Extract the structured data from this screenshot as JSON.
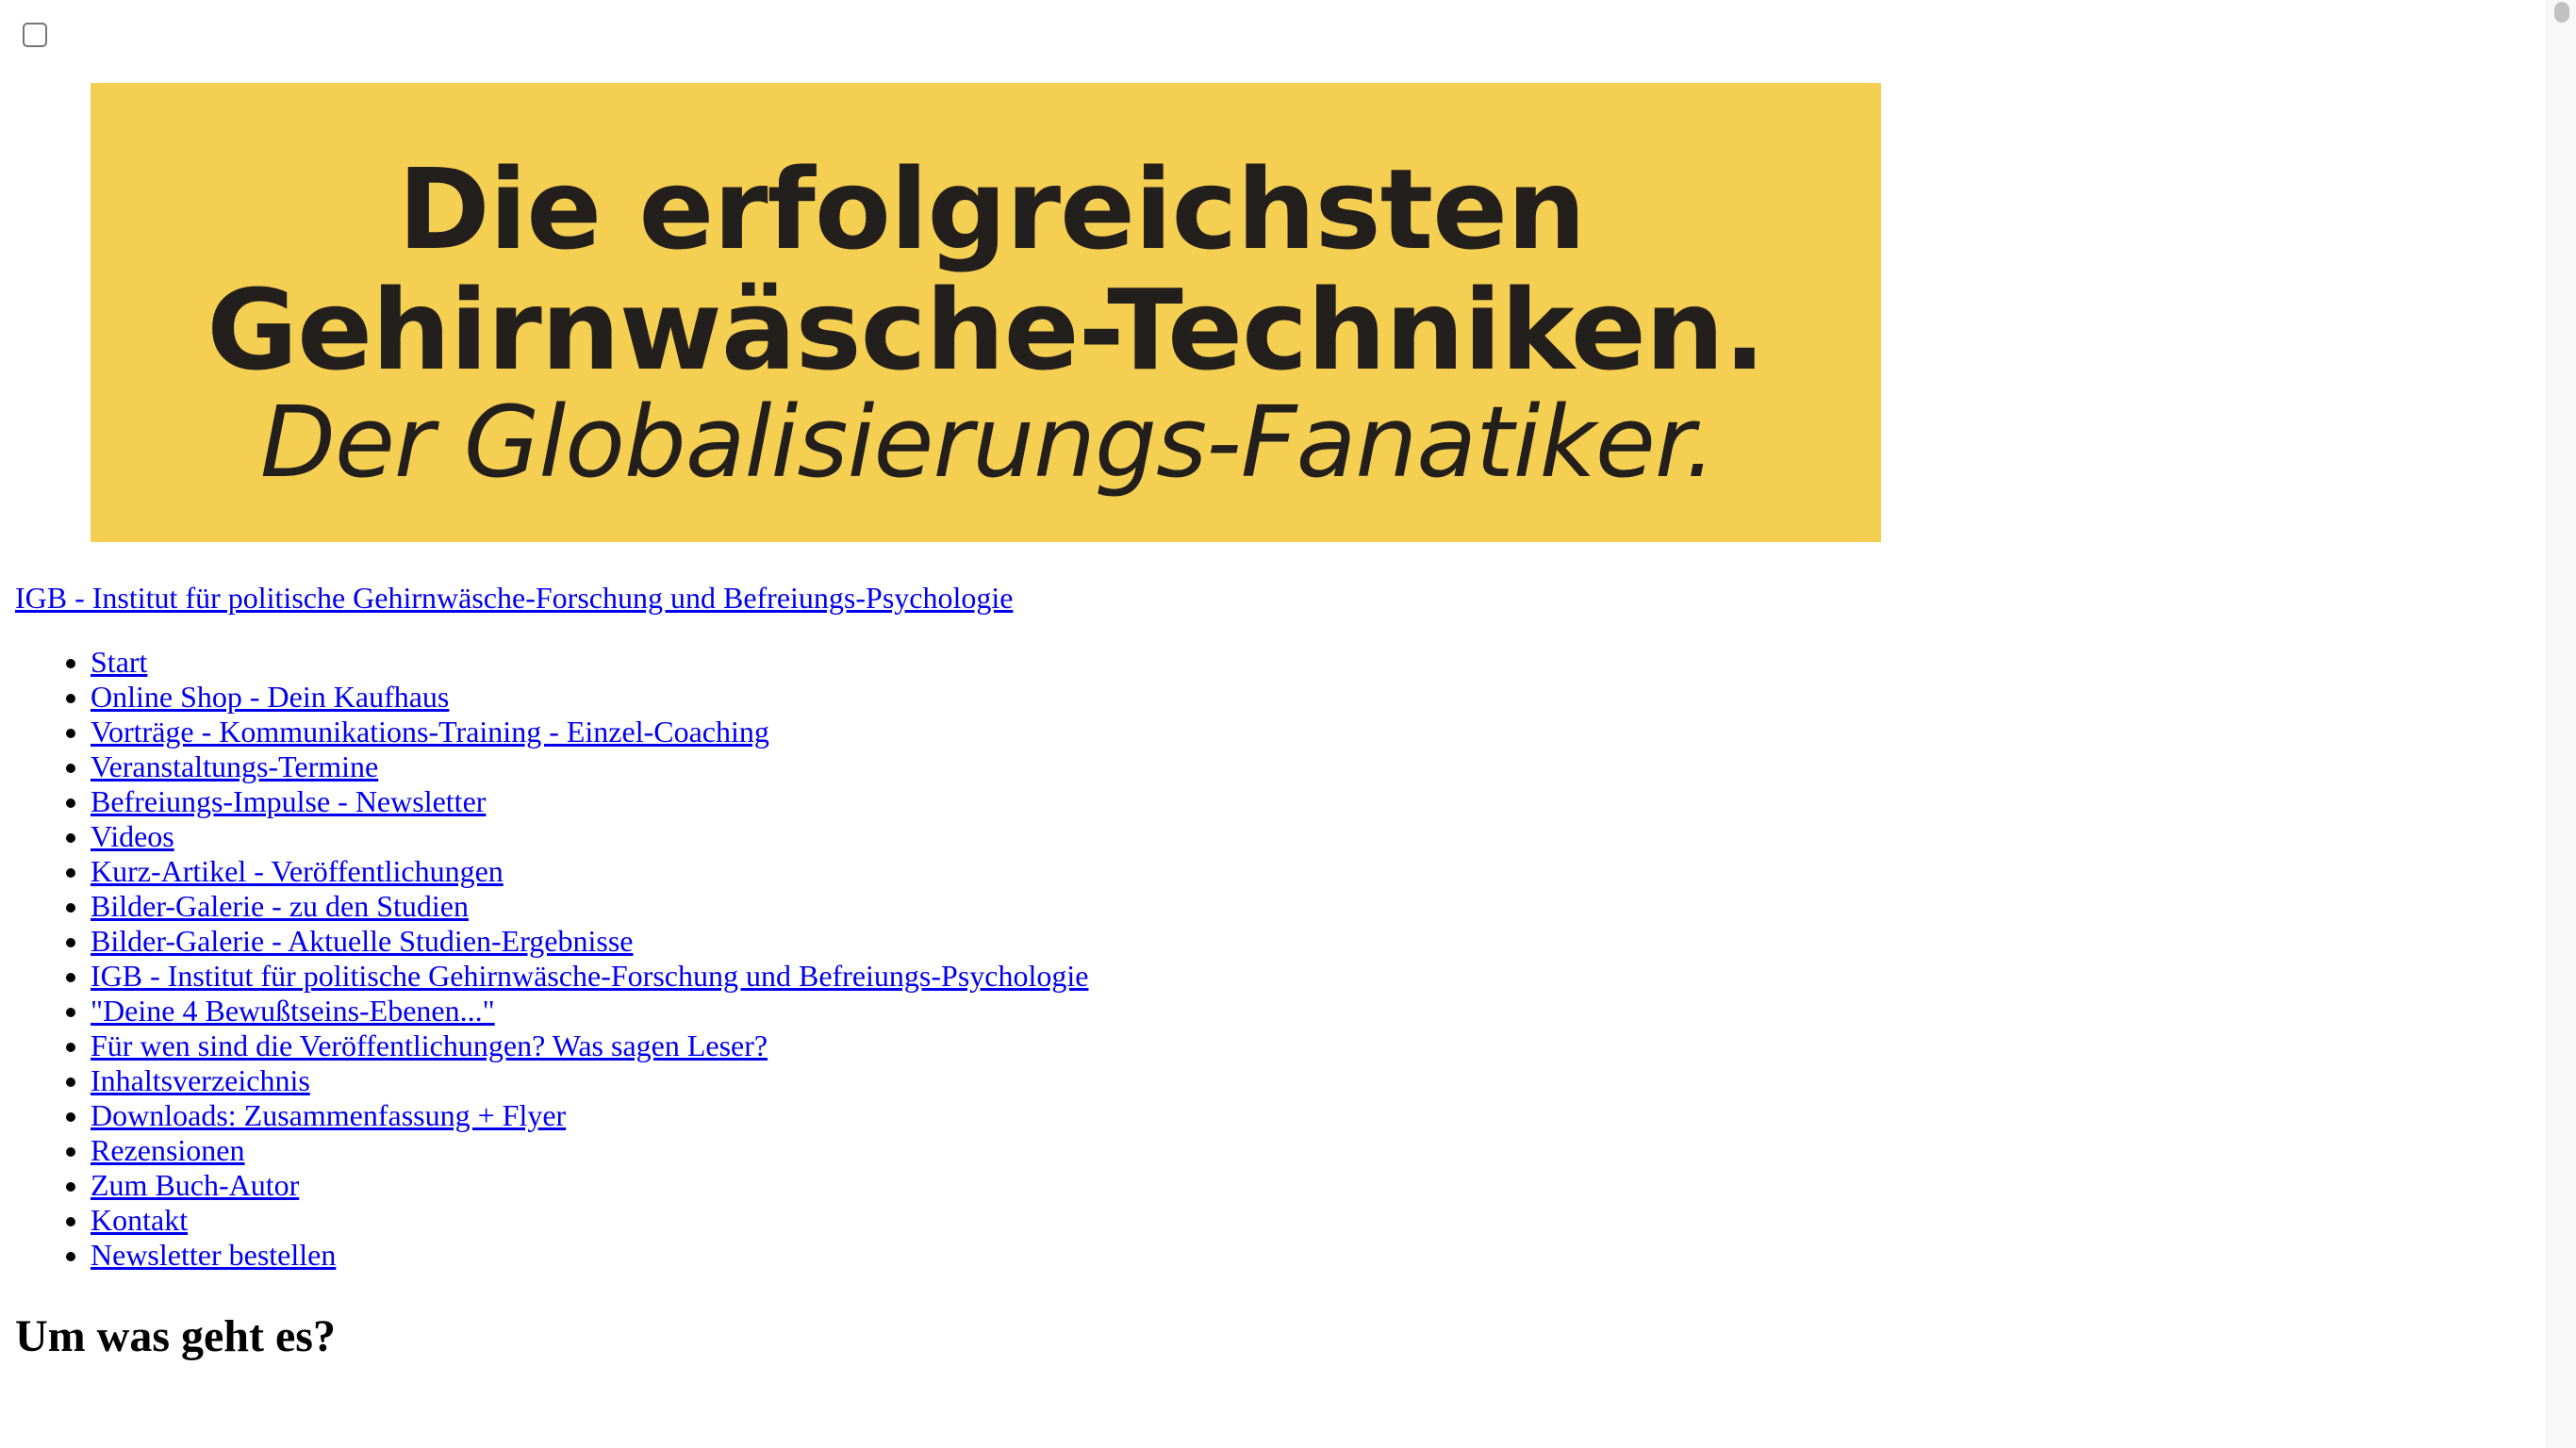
{
  "menu_toggle": {
    "checked": false,
    "icon": "checkbox-icon"
  },
  "banner": {
    "line1": "Die erfolgreichsten",
    "line2": "Gehirnwäsche-Techniken.",
    "line3": "Der Globalisierungs-Fanatiker.",
    "background_color": "#f5cf51",
    "text_color": "#231f1c"
  },
  "site_title": "IGB - Institut für politische Gehirnwäsche-Forschung und Befreiungs-Psychologie",
  "nav": {
    "items": [
      "Start",
      "Online Shop - Dein Kaufhaus",
      "Vorträge - Kommunikations-Training - Einzel-Coaching",
      "Veranstaltungs-Termine",
      "Befreiungs-Impulse - Newsletter",
      "Videos",
      "Kurz-Artikel - Veröffentlichungen",
      "Bilder-Galerie - zu den Studien",
      "Bilder-Galerie - Aktuelle Studien-Ergebnisse",
      "IGB - Institut für politische Gehirnwäsche-Forschung und Befreiungs-Psychologie",
      "\"Deine 4 Bewußtseins-Ebenen...\"",
      "Für wen sind die Veröffentlichungen? Was sagen Leser?",
      "Inhaltsverzeichnis",
      "Downloads: Zusammenfassung + Flyer",
      "Rezensionen",
      "Zum Buch-Autor",
      "Kontakt",
      "Newsletter bestellen"
    ]
  },
  "main": {
    "heading": "Um was geht es?"
  },
  "colors": {
    "link": "#0000ee",
    "text": "#000000",
    "background": "#ffffff"
  }
}
